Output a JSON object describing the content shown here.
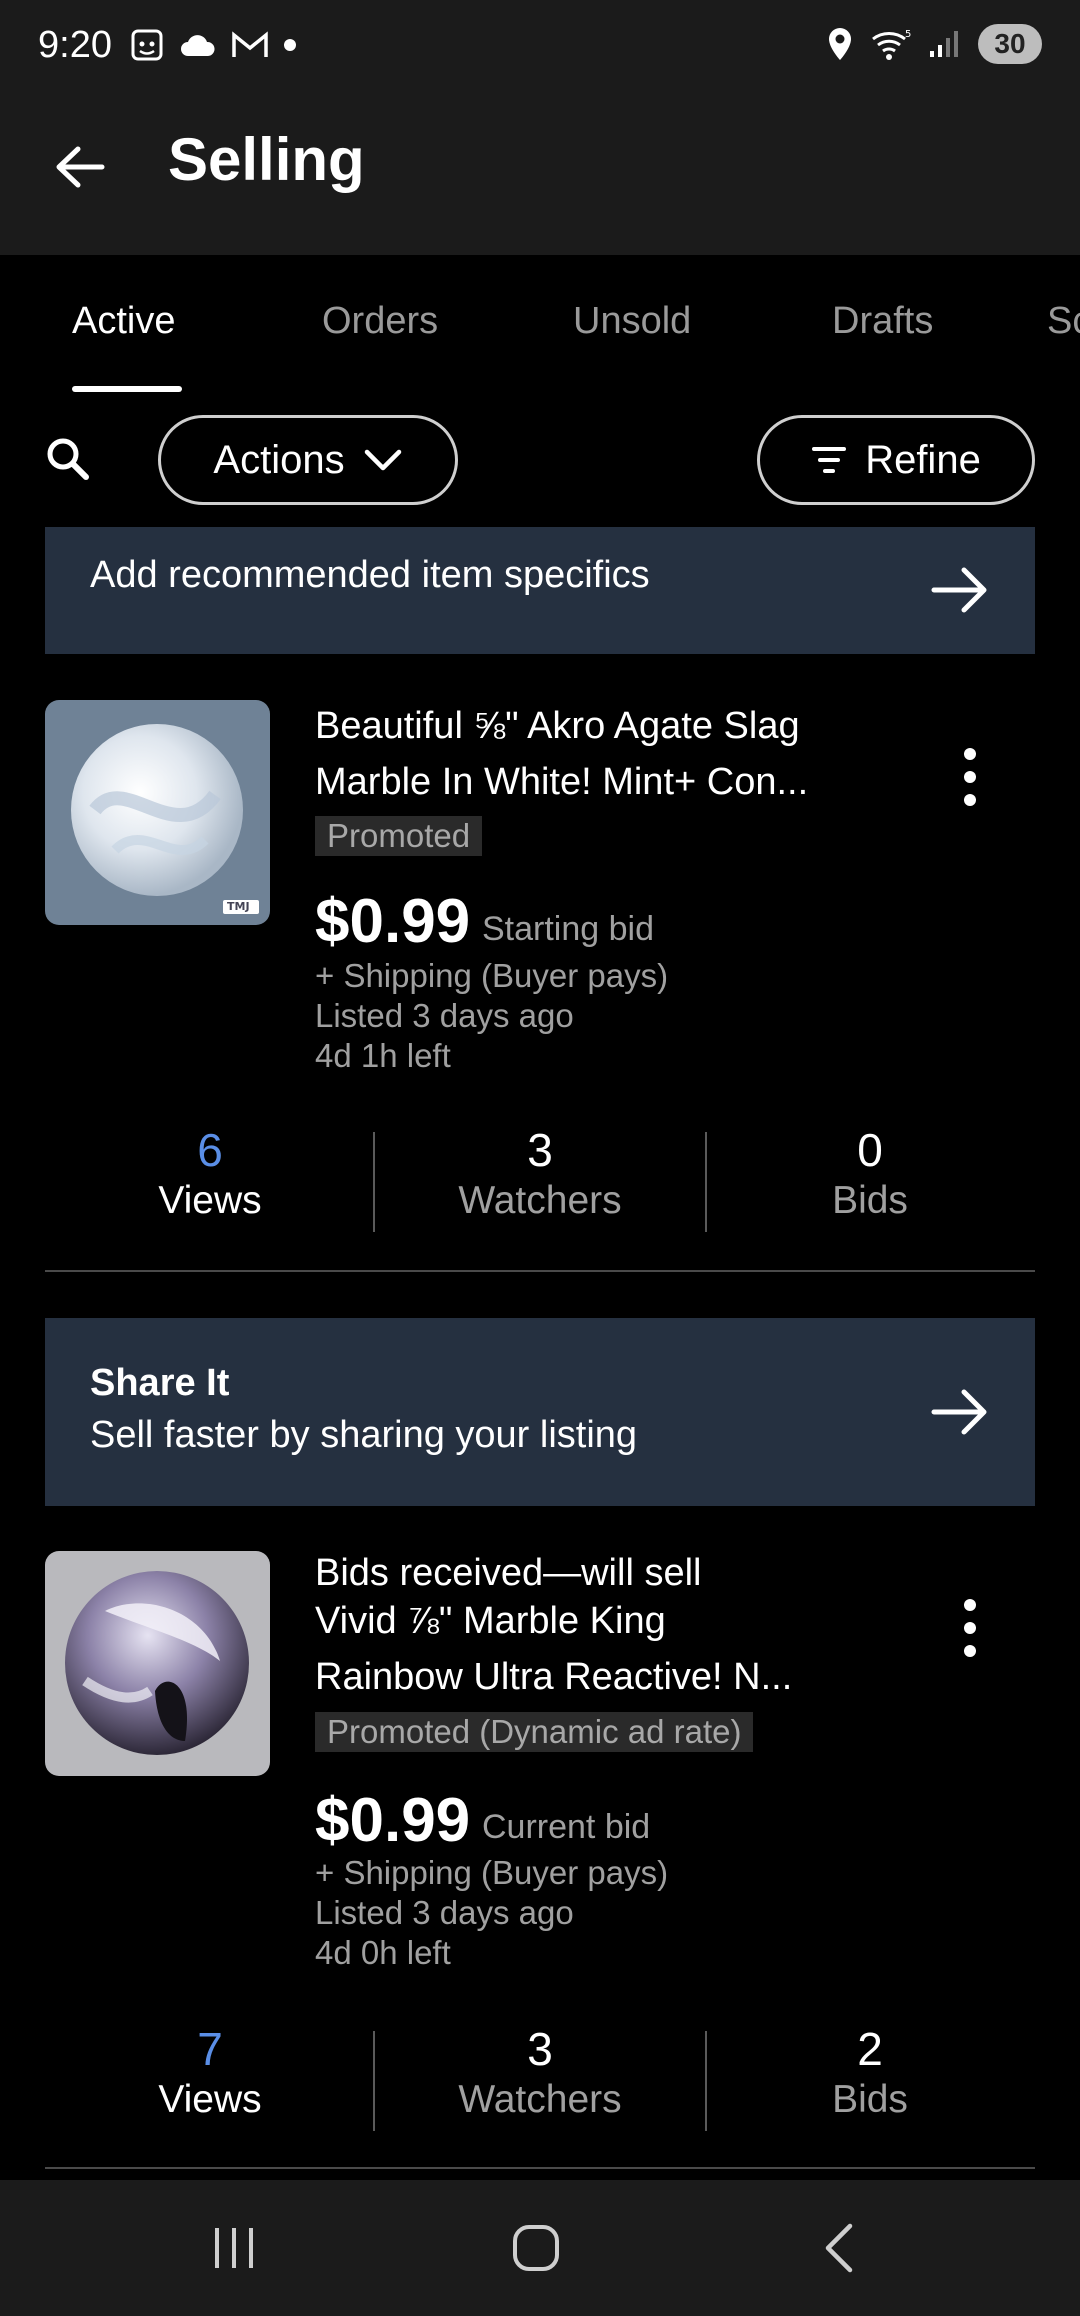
{
  "status_bar": {
    "time": "9:20",
    "battery": "30",
    "left_icons": [
      "screenshot-icon",
      "cloud-icon",
      "gmail-icon",
      "dot-icon"
    ],
    "right_icons": [
      "location-icon",
      "wifi-icon",
      "signal-icon",
      "battery-icon"
    ]
  },
  "header": {
    "title": "Selling",
    "back_icon": "back-arrow-icon"
  },
  "tabs": [
    {
      "label": "Active",
      "active": true
    },
    {
      "label": "Orders",
      "active": false
    },
    {
      "label": "Unsold",
      "active": false
    },
    {
      "label": "Drafts",
      "active": false
    },
    {
      "label": "Sc",
      "active": false
    }
  ],
  "toolbar": {
    "search_icon": "search-icon",
    "actions_label": "Actions",
    "refine_label": "Refine"
  },
  "banner_specifics": {
    "text": "Add recommended item specifics"
  },
  "listings": [
    {
      "title_line1": "Beautiful ⅝\" Akro Agate Slag",
      "title_line2": "Marble In White! Mint+ Con...",
      "badge": "Promoted",
      "price": "$0.99",
      "price_note": "Starting bid",
      "shipping": "+ Shipping (Buyer pays)",
      "listed": "Listed 3 days ago",
      "time_left": "4d 1h left",
      "thumb_tag": "TMJ",
      "stats": [
        {
          "value": "6",
          "label": "Views"
        },
        {
          "value": "3",
          "label": "Watchers"
        },
        {
          "value": "0",
          "label": "Bids"
        }
      ]
    },
    {
      "title_line1": "Bids received—will sell",
      "title_line2": "Vivid ⅞\" Marble King",
      "title_line3": "Rainbow Ultra Reactive! N...",
      "badge": "Promoted (Dynamic ad rate)",
      "price": "$0.99",
      "price_note": "Current bid",
      "shipping": "+ Shipping (Buyer pays)",
      "listed": "Listed 3 days ago",
      "time_left": "4d 0h left",
      "stats": [
        {
          "value": "7",
          "label": "Views"
        },
        {
          "value": "3",
          "label": "Watchers"
        },
        {
          "value": "2",
          "label": "Bids"
        }
      ]
    }
  ],
  "banner_share": {
    "title": "Share It",
    "subtitle": "Sell faster by sharing your listing"
  },
  "colors": {
    "accent_blue": "#5a8ee6",
    "banner_bg": "#253040",
    "bar_bg": "#1b1b1b"
  }
}
